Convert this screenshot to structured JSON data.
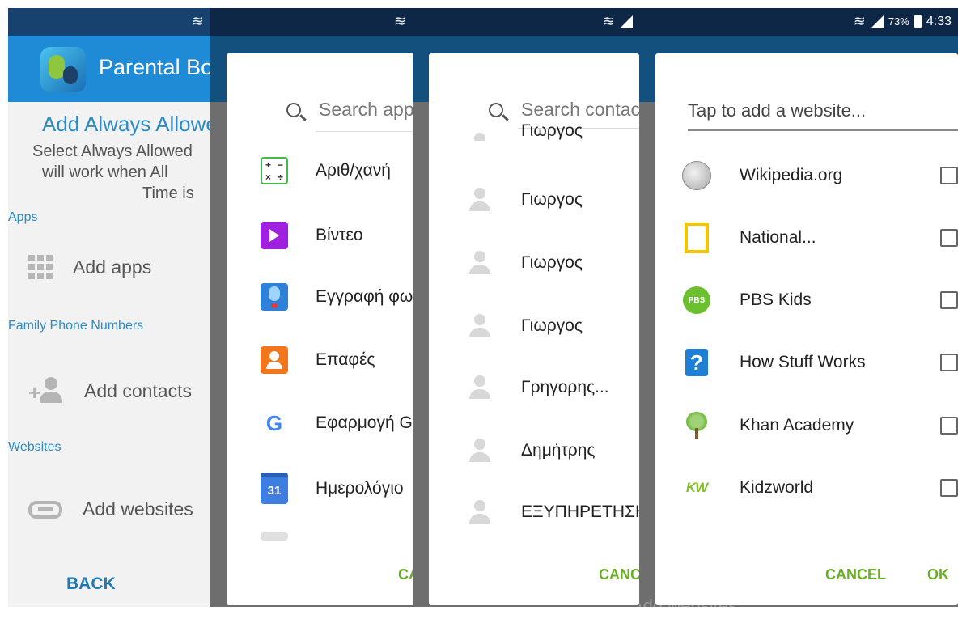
{
  "status_bar": {
    "battery": "73%",
    "time": "4:33"
  },
  "panel1": {
    "app_title": "Parental Board",
    "heading": "Add Always Allowed",
    "description": [
      "Select Always Allowed",
      "will work when All",
      "Time is"
    ],
    "sections": {
      "apps": "Apps",
      "family": "Family Phone Numbers",
      "websites": "Websites"
    },
    "rows": {
      "apps": "Add apps",
      "contacts": "Add contacts",
      "websites": "Add websites"
    },
    "back": "BACK"
  },
  "panel2": {
    "search_placeholder": "Search apps",
    "apps": [
      {
        "label": "Αριθ/χανή",
        "icon": "calculator-icon"
      },
      {
        "label": "Βίντεο",
        "icon": "video-icon"
      },
      {
        "label": "Εγγραφή φωνής",
        "icon": "voice-recorder-icon"
      },
      {
        "label": "Επαφές",
        "icon": "contacts-icon"
      },
      {
        "label": "Εφαρμογή Google",
        "icon": "google-icon"
      },
      {
        "label": "Ημερολόγιο",
        "icon": "calendar-icon"
      }
    ],
    "calendar_day": "31",
    "cancel": "CANCEL"
  },
  "panel3": {
    "search_placeholder": "Search contacts",
    "partial_top": "Γιωργος",
    "contacts": [
      "Γιωργος",
      "Γιωργος",
      "Γιωργος",
      "Γρηγορης...",
      "Δημήτρης",
      "ΕΞΥΠΗΡΕΤΗΣΗ"
    ],
    "cancel": "CANCEL"
  },
  "panel4": {
    "input_placeholder": "Tap to add a website...",
    "websites": [
      {
        "label": "Wikipedia.org",
        "icon": "wikipedia-icon"
      },
      {
        "label": "National...",
        "icon": "national-geographic-icon"
      },
      {
        "label": "PBS Kids",
        "icon": "pbs-kids-icon"
      },
      {
        "label": "How Stuff Works",
        "icon": "how-stuff-works-icon"
      },
      {
        "label": "Khan Academy",
        "icon": "khan-academy-icon"
      },
      {
        "label": "Kidzworld",
        "icon": "kidzworld-icon"
      }
    ],
    "pbs_logo_text": "PBS",
    "hsw_logo_text": "?",
    "kidz_logo_text": "KW",
    "cancel": "CANCEL",
    "ok": "OK",
    "behind_text": "Add websites"
  }
}
